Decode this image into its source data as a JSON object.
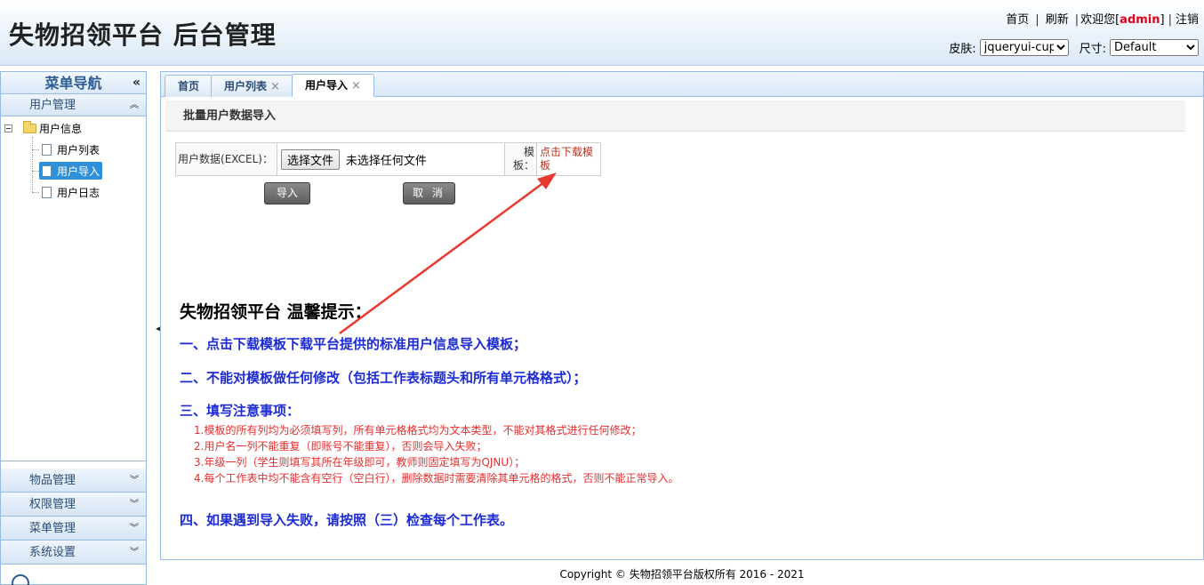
{
  "app": {
    "title": "失物招领平台 后台管理"
  },
  "header": {
    "home": "首页",
    "refresh": "刷新",
    "sep": "|",
    "welcome": "欢迎您[",
    "username": "admin",
    "welcome_end": "]",
    "logout": "注销",
    "skin_label": "皮肤:",
    "skin_value": "jqueryui-cupe",
    "size_label": "尺寸:",
    "size_value": "Default"
  },
  "sidebar": {
    "title": "菜单导航",
    "collapse_glyph": "«",
    "sections": [
      {
        "label": "用户管理",
        "expanded": true
      },
      {
        "label": "物品管理",
        "expanded": false
      },
      {
        "label": "权限管理",
        "expanded": false
      },
      {
        "label": "菜单管理",
        "expanded": false
      },
      {
        "label": "系统设置",
        "expanded": false
      }
    ],
    "tree": {
      "root": "用户信息",
      "children": [
        "用户列表",
        "用户导入",
        "用户日志"
      ],
      "selected": "用户导入"
    }
  },
  "tabs": [
    {
      "label": "首页",
      "closable": false,
      "active": false
    },
    {
      "label": "用户列表",
      "closable": true,
      "active": false
    },
    {
      "label": "用户导入",
      "closable": true,
      "active": true
    }
  ],
  "close_glyph": "×",
  "page": {
    "section_title": "批量用户数据导入",
    "form": {
      "file_label": "用户数据(EXCEL)：",
      "file_button": "选择文件",
      "file_status": "未选择任何文件",
      "template_label": "模板：",
      "template_link": "点击下载模板"
    },
    "buttons": {
      "import": "导入",
      "cancel": "取 消"
    },
    "tips": {
      "title": "失物招领平台 温馨提示：",
      "items": [
        "一、点击下载模板下载平台提供的标准用户信息导入模板；",
        "二、不能对模板做任何修改（包括工作表标题头和所有单元格格式）；",
        "三、填写注意事项：",
        "四、如果遇到导入失败，请按照（三）检查每个工作表。"
      ],
      "sub_items": [
        "1.模板的所有列均为必须填写列，所有单元格格式均为文本类型，不能对其格式进行任何修改；",
        "2.用户名一列不能重复（即账号不能重复），否则会导入失败；",
        "3.年级一列（学生则填写其所在年级即可，教师则固定填写为QJNU）；",
        "4.每个工作表中均不能含有空行（空白行），删除数据时需要清除其单元格的格式，否则不能正常导入。"
      ]
    }
  },
  "footer": {
    "copyright": "Copyright © 失物招领平台版权所有  2016 - 2021"
  },
  "colors": {
    "link_red": "#e0001b",
    "tip_blue": "#1c2bd6",
    "sub_red": "#e62e2e",
    "selected_blue": "#2f8fd7",
    "arrow_red": "#e8392f"
  }
}
